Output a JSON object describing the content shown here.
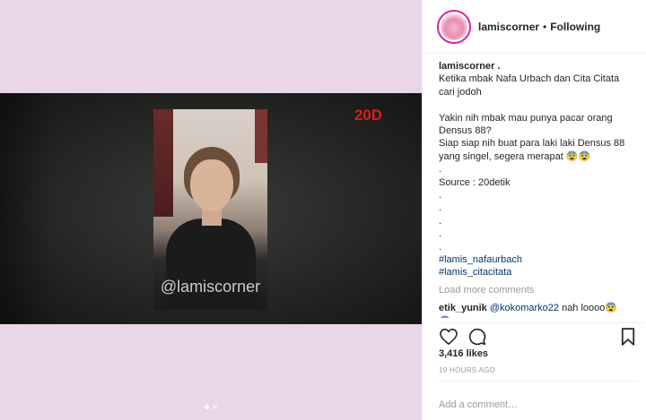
{
  "post": {
    "username": "lamiscorner",
    "follow_status": "Following",
    "separator": "•"
  },
  "media": {
    "watermark": "@lamiscorner",
    "channel_logo": "20D",
    "carousel": {
      "count": 2,
      "active": 0
    }
  },
  "caption": {
    "user": "lamiscorner .",
    "lines": [
      "Ketika mbak Nafa Urbach dan Cita Citata",
      "cari jodoh",
      "",
      "Yakin nih mbak mau punya pacar orang",
      "Densus 88?",
      "Siap siap nih buat para laki laki Densus 88",
      "yang singel, segera merapat 😨😨",
      ".",
      "Source : 20detik",
      ".",
      ".",
      ".",
      ".",
      "."
    ],
    "tags": [
      "#lamis_nafaurbach",
      "#lamis_citacitata"
    ]
  },
  "comments": {
    "load_more": "Load more comments",
    "items": [
      {
        "user": "etik_yunik",
        "mention": "@kokomarko22",
        "text": " nah loooo😨",
        "extra": "😨"
      }
    ]
  },
  "actions": {
    "like_icon": "heart-icon",
    "comment_icon": "comment-icon",
    "save_icon": "bookmark-icon"
  },
  "likes": "3,416 likes",
  "timestamp": "19 HOURS AGO",
  "add_comment": {
    "placeholder": "Add a comment…"
  },
  "colors": {
    "media_bg": "#e9d6e7",
    "link": "#003569",
    "muted": "#999999",
    "story_ring": "#d6249f",
    "channel_logo": "#d81f1f"
  }
}
